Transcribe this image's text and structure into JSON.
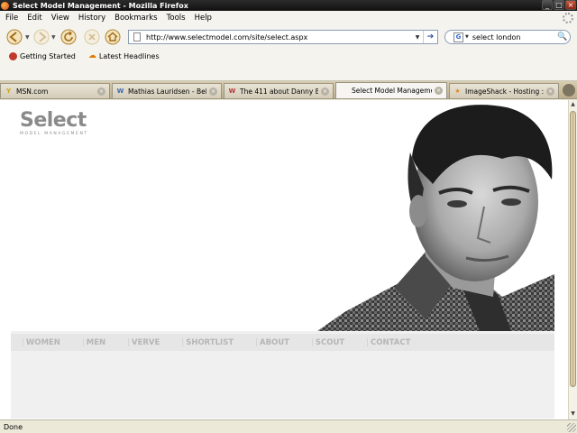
{
  "window": {
    "title": "Select Model Management - Mozilla Firefox"
  },
  "menu": [
    {
      "label": "File",
      "key": "file"
    },
    {
      "label": "Edit",
      "key": "edit"
    },
    {
      "label": "View",
      "key": "view"
    },
    {
      "label": "History",
      "key": "history"
    },
    {
      "label": "Bookmarks",
      "key": "bookmarks"
    },
    {
      "label": "Tools",
      "key": "tools"
    },
    {
      "label": "Help",
      "key": "help"
    }
  ],
  "toolbar": {
    "url": "http://www.selectmodel.com/site/select.aspx",
    "search_value": "select london",
    "search_engine": "G"
  },
  "bookmarks": [
    {
      "label": "Getting Started"
    },
    {
      "label": "Latest Headlines"
    }
  ],
  "tabs": [
    {
      "label": "MSN.com",
      "fav": "Y",
      "color": "#d4a017",
      "active": false
    },
    {
      "label": "Mathias Lauridsen - Bell...",
      "fav": "W",
      "color": "#3d6bb3",
      "active": false
    },
    {
      "label": "The 411 about Danny Be...",
      "fav": "W",
      "color": "#b23a3a",
      "active": false
    },
    {
      "label": "Select Model Management",
      "fav": "",
      "color": "#ffffff",
      "active": true
    },
    {
      "label": "ImageShack - Hosting ::...",
      "fav": "★",
      "color": "#e08a1b",
      "active": false
    }
  ],
  "site": {
    "logo_main": "Select",
    "logo_sub": "MODEL MANAGEMENT",
    "nav": [
      "WOMEN",
      "MEN",
      "VERVE",
      "SHORTLIST",
      "ABOUT",
      "SCOUT",
      "CONTACT"
    ]
  },
  "status": {
    "text": "Done"
  }
}
